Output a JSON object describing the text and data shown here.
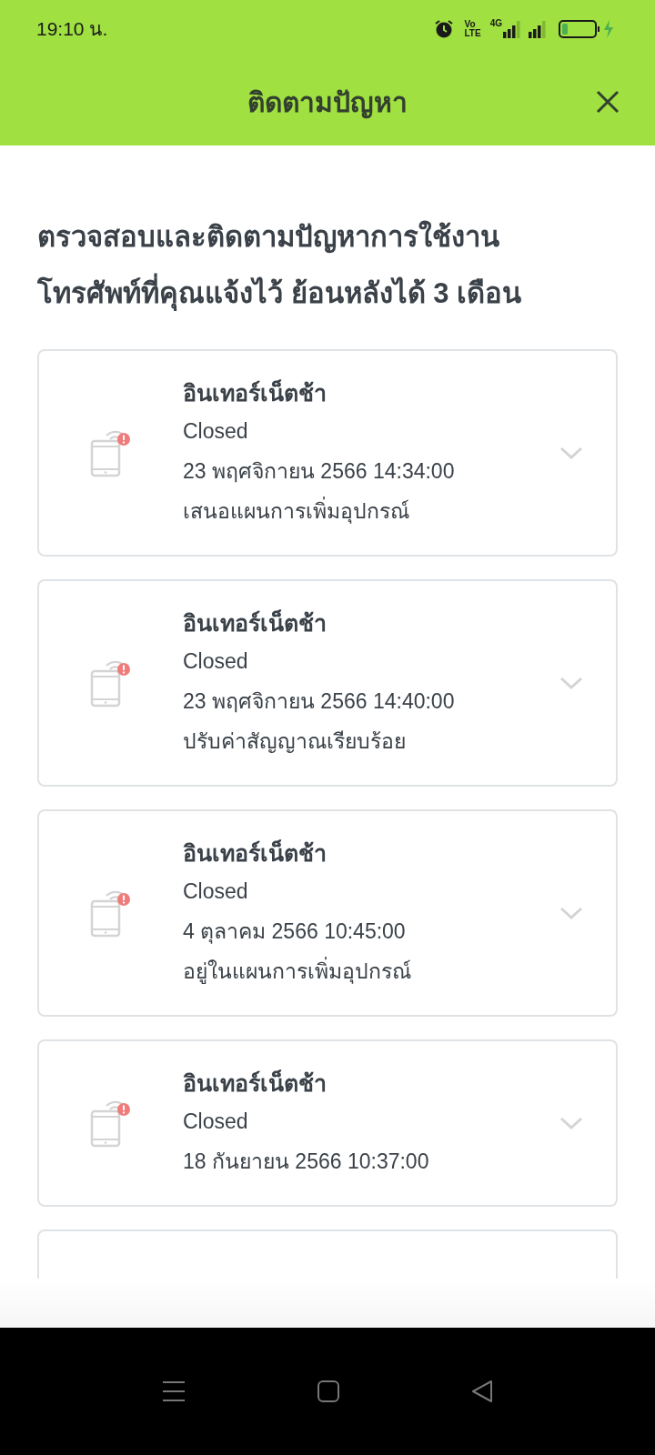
{
  "status_bar": {
    "time": "19:10 น.",
    "volte": [
      "Vo",
      "LTE"
    ],
    "network": "4G"
  },
  "header": {
    "title": "ติดตามปัญหา"
  },
  "intro": "ตรวจสอบและติดตามปัญหาการใช้งานโทรศัพท์ที่คุณแจ้งไว้ ย้อนหลังได้ 3 เดือน",
  "issues": [
    {
      "title": "อินเทอร์เน็ตช้า",
      "status": "Closed",
      "datetime": "23 พฤศจิกายน 2566 14:34:00",
      "note": "เสนอแผนการเพิ่มอุปกรณ์",
      "expanded": false
    },
    {
      "title": "อินเทอร์เน็ตช้า",
      "status": "Closed",
      "datetime": "23 พฤศจิกายน 2566 14:40:00",
      "note": "ปรับค่าสัญญาณเรียบร้อย",
      "expanded": false
    },
    {
      "title": "อินเทอร์เน็ตช้า",
      "status": "Closed",
      "datetime": "4 ตุลาคม 2566 10:45:00",
      "note": "อยู่ในแผนการเพิ่มอุปกรณ์",
      "expanded": false
    },
    {
      "title": "อินเทอร์เน็ตช้า",
      "status": "Closed",
      "datetime": "18 กันยายน 2566 10:37:00",
      "expanded": false
    }
  ]
}
